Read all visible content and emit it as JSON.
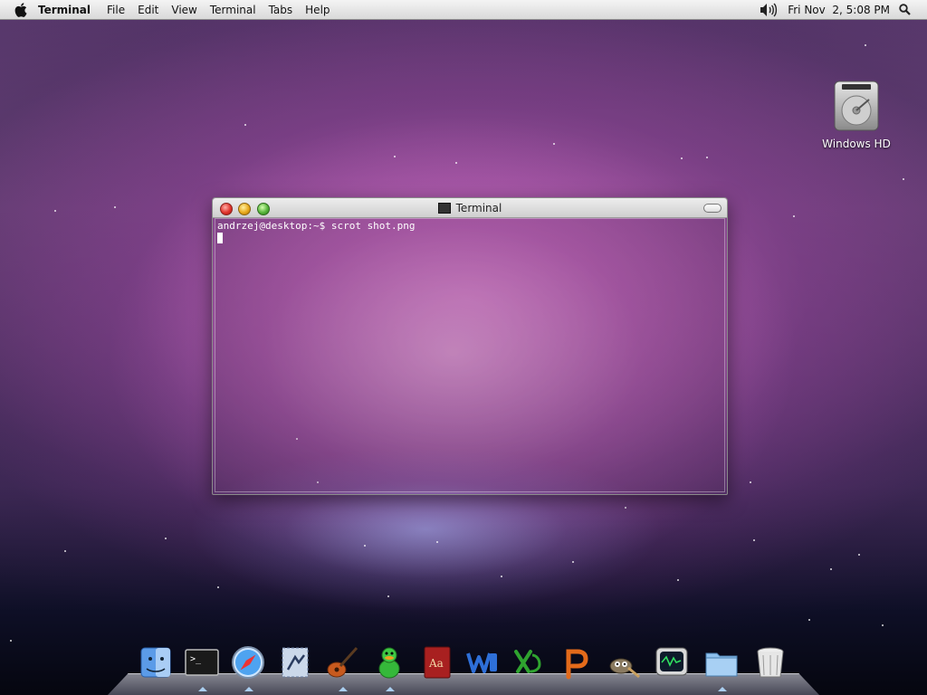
{
  "menubar": {
    "app_name": "Terminal",
    "menus": [
      "File",
      "Edit",
      "View",
      "Terminal",
      "Tabs",
      "Help"
    ],
    "clock": "Fri Nov  2, 5:08 PM",
    "icons": [
      "apple-icon",
      "volume-icon",
      "spotlight-icon"
    ]
  },
  "desktop_icon": {
    "label": "Windows HD",
    "icon": "hard-drive-icon"
  },
  "terminal": {
    "title": "Terminal",
    "prompt_line": "andrzej@desktop:~$ scrot shot.png"
  },
  "dock": {
    "items": [
      {
        "name": "finder",
        "icon": "finder-icon",
        "running": false
      },
      {
        "name": "terminal",
        "icon": "terminal-icon",
        "running": true
      },
      {
        "name": "safari",
        "icon": "safari-icon",
        "running": true
      },
      {
        "name": "mail",
        "icon": "mail-icon",
        "running": false
      },
      {
        "name": "garageband",
        "icon": "guitar-icon",
        "running": true
      },
      {
        "name": "adium",
        "icon": "duck-icon",
        "running": true
      },
      {
        "name": "dictionary",
        "icon": "dictionary-icon",
        "running": false
      },
      {
        "name": "word",
        "icon": "word-icon",
        "running": false
      },
      {
        "name": "excel",
        "icon": "excel-icon",
        "running": false
      },
      {
        "name": "powerpoint",
        "icon": "powerpoint-icon",
        "running": false
      },
      {
        "name": "gimp",
        "icon": "gimp-icon",
        "running": false
      },
      {
        "name": "activity-monitor",
        "icon": "monitor-icon",
        "running": false
      },
      {
        "name": "downloads-folder",
        "icon": "folder-icon",
        "running": true
      },
      {
        "name": "trash",
        "icon": "trash-icon",
        "running": false
      }
    ]
  },
  "colors": {
    "accent_close": "#e0332b",
    "accent_minimize": "#e8a91c",
    "accent_zoom": "#56b43a"
  }
}
